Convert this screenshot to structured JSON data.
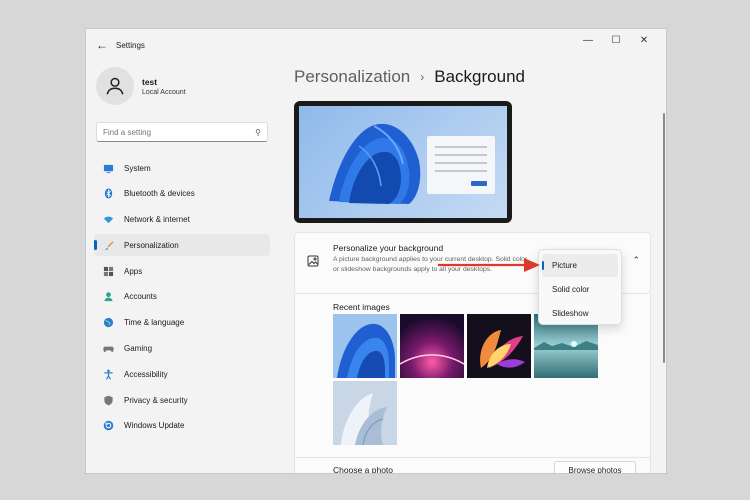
{
  "window": {
    "title": "Settings"
  },
  "profile": {
    "name": "test",
    "account_type": "Local Account"
  },
  "search": {
    "placeholder": "Find a setting"
  },
  "nav": {
    "items": [
      {
        "label": "System",
        "icon": "monitor-icon",
        "active": false
      },
      {
        "label": "Bluetooth & devices",
        "icon": "bluetooth-icon",
        "active": false
      },
      {
        "label": "Network & internet",
        "icon": "wifi-icon",
        "active": false
      },
      {
        "label": "Personalization",
        "icon": "brush-icon",
        "active": true
      },
      {
        "label": "Apps",
        "icon": "apps-icon",
        "active": false
      },
      {
        "label": "Accounts",
        "icon": "person-icon",
        "active": false
      },
      {
        "label": "Time & language",
        "icon": "globe-icon",
        "active": false
      },
      {
        "label": "Gaming",
        "icon": "gamepad-icon",
        "active": false
      },
      {
        "label": "Accessibility",
        "icon": "accessibility-icon",
        "active": false
      },
      {
        "label": "Privacy & security",
        "icon": "shield-icon",
        "active": false
      },
      {
        "label": "Windows Update",
        "icon": "update-icon",
        "active": false
      }
    ]
  },
  "breadcrumb": {
    "parent": "Personalization",
    "separator": "›",
    "current": "Background"
  },
  "background_card": {
    "title": "Personalize your background",
    "description": "A picture background applies to your current desktop. Solid color or slideshow backgrounds apply to all your desktops."
  },
  "dropdown": {
    "options": [
      "Picture",
      "Solid color",
      "Slideshow"
    ],
    "selected": "Picture"
  },
  "recent": {
    "title": "Recent images"
  },
  "choose_photo": {
    "label": "Choose a photo",
    "button": "Browse photos"
  },
  "colors": {
    "accent": "#0067c0",
    "arrow": "#d93a2b"
  }
}
